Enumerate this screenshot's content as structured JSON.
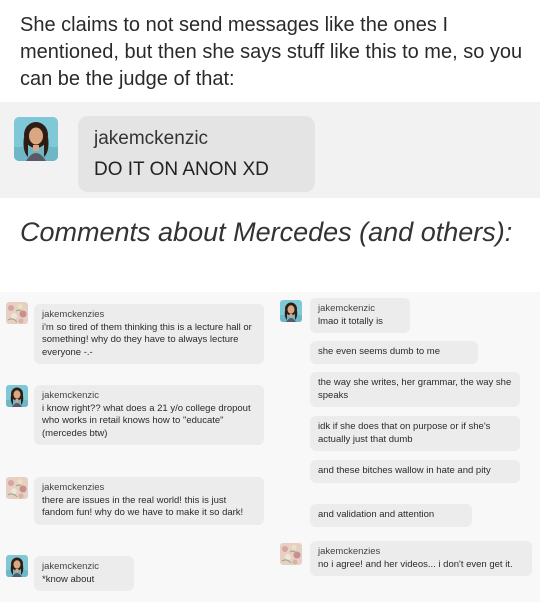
{
  "intro_text": "She claims to not send messages like the ones I mentioned, but then she says stuff like this to me, so you can be the judge of that:",
  "top_message": {
    "username": "jakemckenzic",
    "text": "DO IT ON ANON XD"
  },
  "section_heading": "Comments about Mercedes (and others):",
  "left_messages": [
    {
      "username": "jakemckenzies",
      "text": "i'm so tired of them thinking this is a lecture hall or something! why do they have to always lecture everyone -.-"
    },
    {
      "username": "jakemckenzic",
      "text": "i know right?? what does a 21 y/o college dropout who works in retail knows how to \"educate\" (mercedes btw)"
    },
    {
      "username": "jakemckenzies",
      "text": "there are issues in the real world! this is just fandom fun! why do we have to make it so dark!"
    },
    {
      "username": "jakemckenzic",
      "text": "*know about"
    }
  ],
  "right_messages": [
    {
      "username": "jakemckenzic",
      "text": "lmao it totally is"
    },
    {
      "text": "she even seems dumb to me"
    },
    {
      "text": "the way she writes, her grammar, the way she speaks"
    },
    {
      "text": "idk if she does that on purpose or if she's actually just that dumb"
    },
    {
      "text": "and these bitches wallow in hate and pity"
    },
    {
      "text": "and validation and attention"
    },
    {
      "username": "jakemckenzies",
      "text": "no i agree! and her videos... i don't even get it."
    }
  ]
}
